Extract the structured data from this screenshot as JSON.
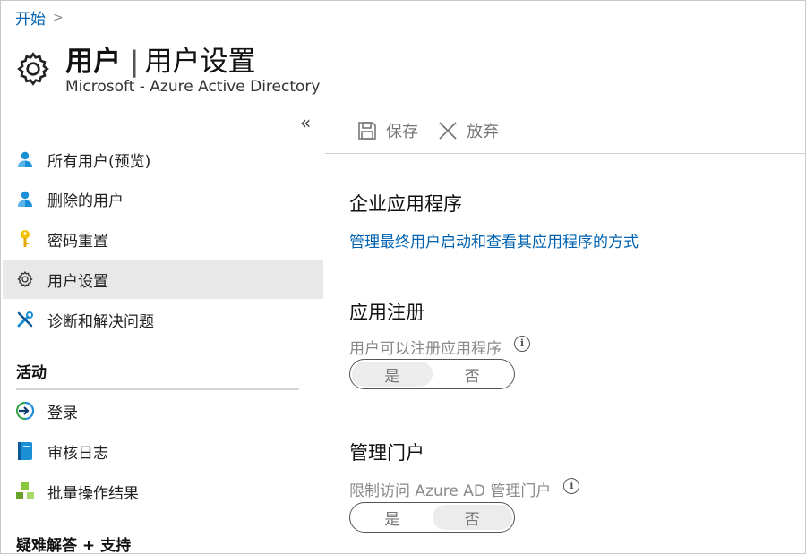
{
  "breadcrumb": {
    "root": "开始",
    "separator": ">"
  },
  "header": {
    "icon": "gear-icon",
    "title_main": "用户",
    "title_sep": "|",
    "title_sub": "用户设置",
    "subtitle": "Microsoft - Azure Active Directory"
  },
  "nav": {
    "collapse_glyph": "«",
    "items": [
      {
        "label": "所有用户(预览)",
        "icon": "user-icon"
      },
      {
        "label": "删除的用户",
        "icon": "user-icon"
      },
      {
        "label": "密码重置",
        "icon": "key-icon"
      },
      {
        "label": "用户设置",
        "icon": "gear-icon",
        "active": true
      },
      {
        "label": "诊断和解决问题",
        "icon": "wrench-icon"
      }
    ],
    "section_activity": "活动",
    "activity_items": [
      {
        "label": "登录",
        "icon": "sign-in-icon"
      },
      {
        "label": "审核日志",
        "icon": "book-icon"
      },
      {
        "label": "批量操作结果",
        "icon": "cubes-icon"
      }
    ],
    "section_support": "疑难解答 + 支持"
  },
  "toolbar": {
    "save_label": "保存",
    "discard_label": "放弃"
  },
  "content": {
    "enterprise_heading": "企业应用程序",
    "enterprise_link": "管理最终用户启动和查看其应用程序的方式",
    "app_reg_heading": "应用注册",
    "app_reg_label": "用户可以注册应用程序",
    "app_reg_toggle": {
      "yes": "是",
      "no": "否",
      "selected": "yes"
    },
    "admin_portal_heading": "管理门户",
    "admin_portal_label": "限制访问 Azure AD 管理门户",
    "admin_portal_toggle": {
      "yes": "是",
      "no": "否",
      "selected": "no"
    },
    "info_glyph": "i"
  },
  "colors": {
    "link": "#0063b1",
    "active_bg": "#e8e8e8",
    "user_icon": "#1a8fd6",
    "key_icon": "#f2c200"
  }
}
